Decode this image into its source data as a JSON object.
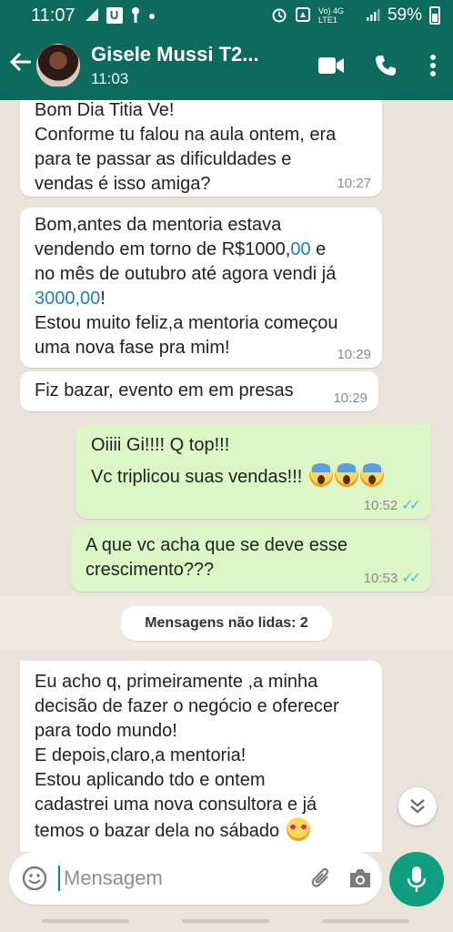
{
  "status_bar": {
    "time": "11:07",
    "left_icons": [
      "signal-4g-icon",
      "u-app-icon",
      "key-icon",
      "dot-icon"
    ],
    "network": "Vo) 4G LTE1",
    "battery_percent": "59%",
    "battery_level": 0.59
  },
  "header": {
    "contact_name": "Gisele Mussi T2...",
    "subtitle": "11:03",
    "icons": [
      "back-arrow-icon",
      "video-call-icon",
      "phone-icon",
      "more-vert-icon"
    ]
  },
  "messages": [
    {
      "direction": "in",
      "lines": [
        "Bom Dia Titia Ve!",
        "Conforme tu falou na aula ontem, era",
        "para te passar as dificuldades e",
        "vendas é isso amiga?"
      ],
      "time": "10:27"
    },
    {
      "direction": "in",
      "line1": "Bom,antes da mentoria estava",
      "line2_pre": "vendendo em torno de R$1000,",
      "line2_num": "00",
      "line2_post": " e",
      "line3": "no mês de outubro até agora vendi já",
      "line4_num": "3000,00",
      "line4_post": "!",
      "line5": "Estou muito feliz,a mentoria começou",
      "line6": "uma nova fase pra mim!",
      "time": "10:29"
    },
    {
      "direction": "in",
      "text": "Fiz bazar, evento em em presas",
      "time": "10:29"
    },
    {
      "direction": "out",
      "lines": [
        "Oiiii Gi!!!! Q top!!!",
        "Vc triplicou suas vendas!!!"
      ],
      "emojis": [
        "face-screaming-in-fear",
        "face-screaming-in-fear",
        "face-screaming-in-fear"
      ],
      "time": "10:52",
      "status": "read"
    },
    {
      "direction": "out",
      "lines": [
        "A que vc acha que se deve esse",
        "crescimento???"
      ],
      "time": "10:53",
      "status": "read"
    },
    {
      "direction": "in",
      "lines": [
        "Eu acho q, primeiramente ,a minha",
        "decisão de fazer o negócio e oferecer",
        "para todo mundo!",
        "E depois,claro,a mentoria!",
        "Estou aplicando tdo e ontem",
        "cadastrei uma nova consultora e já",
        "temos o bazar dela no sábado"
      ],
      "emoji": "smiling-face-with-hearts"
    }
  ],
  "unread_label": "Mensagens não lidas: 2",
  "input": {
    "placeholder": "Mensagem"
  },
  "colors": {
    "header": "#0c6b5c",
    "outgoing_bubble": "#dcf7c5",
    "incoming_bubble": "#ffffff",
    "read_ticks": "#4fb6ec",
    "link_number": "#1d80c4",
    "mic_button": "#0f9e80"
  }
}
